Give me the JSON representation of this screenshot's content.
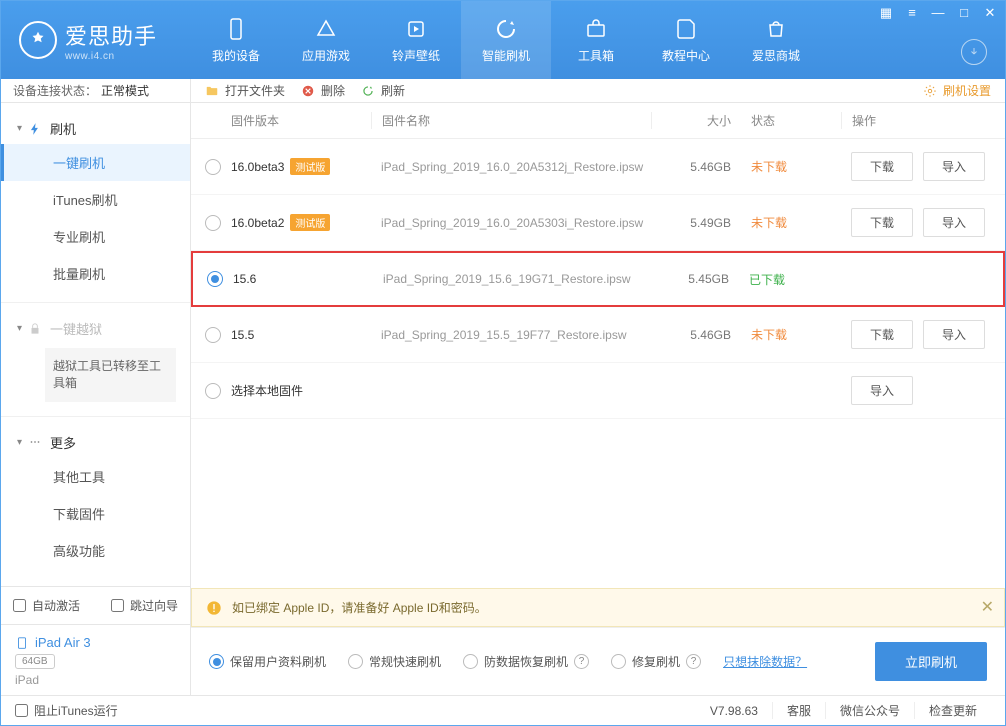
{
  "app": {
    "name": "爱思助手",
    "domain": "www.i4.cn"
  },
  "nav": {
    "items": [
      {
        "label": "我的设备"
      },
      {
        "label": "应用游戏"
      },
      {
        "label": "铃声壁纸"
      },
      {
        "label": "智能刷机"
      },
      {
        "label": "工具箱"
      },
      {
        "label": "教程中心"
      },
      {
        "label": "爱思商城"
      }
    ]
  },
  "sidebar": {
    "status_label": "设备连接状态：",
    "status_mode": "正常模式",
    "flash_group": "刷机",
    "items": [
      {
        "label": "一键刷机"
      },
      {
        "label": "iTunes刷机"
      },
      {
        "label": "专业刷机"
      },
      {
        "label": "批量刷机"
      }
    ],
    "jailbreak": "一键越狱",
    "jailbreak_note": "越狱工具已转移至工具箱",
    "more": "更多",
    "more_items": [
      {
        "label": "其他工具"
      },
      {
        "label": "下载固件"
      },
      {
        "label": "高级功能"
      }
    ],
    "auto_activate": "自动激活",
    "skip_guide": "跳过向导",
    "device": {
      "name": "iPad Air 3",
      "storage": "64GB",
      "type": "iPad"
    }
  },
  "toolbar": {
    "open_folder": "打开文件夹",
    "delete": "删除",
    "refresh": "刷新",
    "settings": "刷机设置"
  },
  "table": {
    "headers": {
      "version": "固件版本",
      "name": "固件名称",
      "size": "大小",
      "status": "状态",
      "ops": "操作"
    },
    "status_not": "未下载",
    "status_done": "已下载",
    "btn_download": "下载",
    "btn_import": "导入",
    "beta_badge": "测试版",
    "rows": [
      {
        "version": "16.0beta3",
        "beta": true,
        "name": "iPad_Spring_2019_16.0_20A5312j_Restore.ipsw",
        "size": "5.46GB",
        "status": "not",
        "selected": false
      },
      {
        "version": "16.0beta2",
        "beta": true,
        "name": "iPad_Spring_2019_16.0_20A5303i_Restore.ipsw",
        "size": "5.49GB",
        "status": "not",
        "selected": false
      },
      {
        "version": "15.6",
        "beta": false,
        "name": "iPad_Spring_2019_15.6_19G71_Restore.ipsw",
        "size": "5.45GB",
        "status": "done",
        "selected": true,
        "highlight": true
      },
      {
        "version": "15.5",
        "beta": false,
        "name": "iPad_Spring_2019_15.5_19F77_Restore.ipsw",
        "size": "5.46GB",
        "status": "not",
        "selected": false
      }
    ],
    "local_row": "选择本地固件"
  },
  "warning": "如已绑定 Apple ID，请准备好 Apple ID和密码。",
  "options": {
    "retain": "保留用户资料刷机",
    "normal": "常规快速刷机",
    "anti": "防数据恢复刷机",
    "repair": "修复刷机",
    "erase_link": "只想抹除数据？",
    "go": "立即刷机"
  },
  "footer": {
    "block_itunes": "阻止iTunes运行",
    "version": "V7.98.63",
    "support": "客服",
    "wechat": "微信公众号",
    "update": "检查更新"
  }
}
